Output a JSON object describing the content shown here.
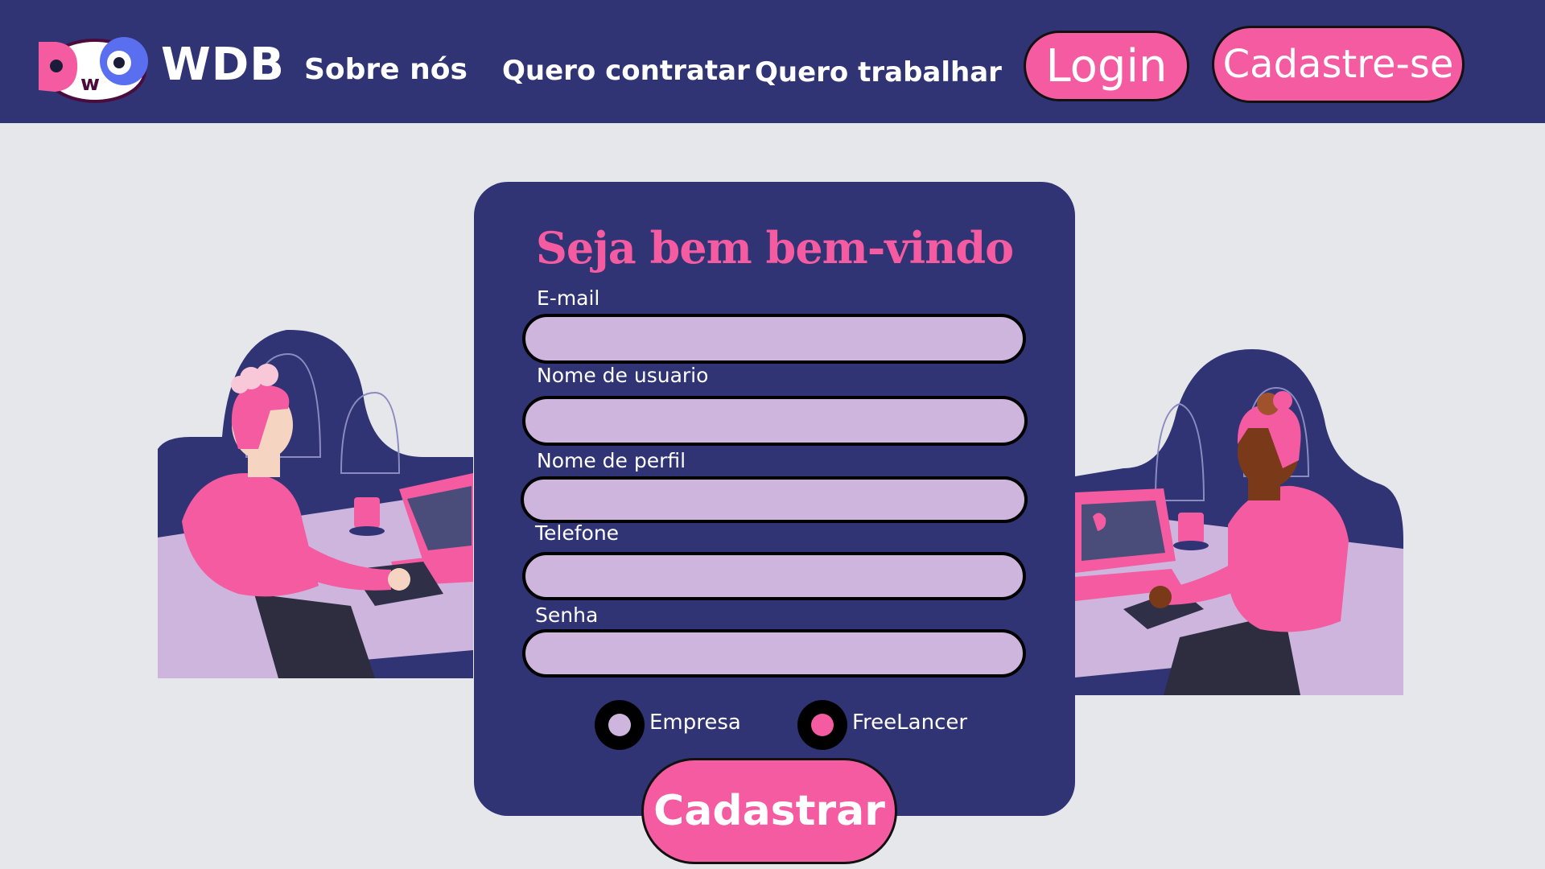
{
  "header": {
    "brand": "WDB",
    "logo_text": "DWO",
    "nav": {
      "about": "Sobre nós",
      "hire": "Quero contratar",
      "work": "Quero trabalhar"
    },
    "login_label": "Login",
    "signup_label": "Cadastre-se"
  },
  "form": {
    "title": "Seja bem bem-vindo",
    "fields": {
      "email": "E-mail",
      "username": "Nome de usuario",
      "profile": "Nome de perfil",
      "phone": "Telefone",
      "password": "Senha"
    },
    "account_type": {
      "company": "Empresa",
      "freelancer": "FreeLancer",
      "selected": "FreeLancer"
    },
    "submit_label": "Cadastrar"
  },
  "colors": {
    "navy": "#303374",
    "pink": "#f45ba0",
    "lavender": "#cdb5dd",
    "background": "#e6e7eb"
  }
}
